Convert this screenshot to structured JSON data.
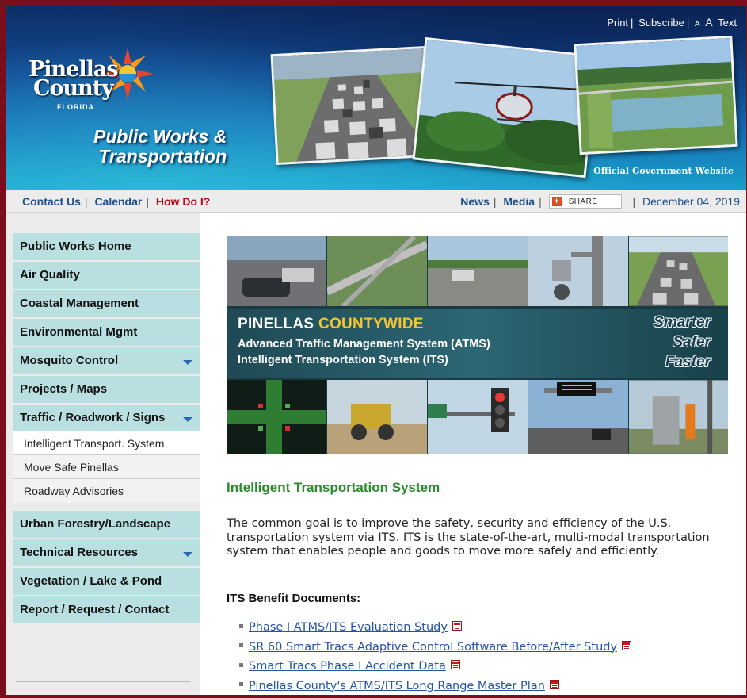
{
  "header": {
    "utility_links": {
      "print": "Print",
      "subscribe": "Subscribe",
      "text_small": "A",
      "text_large": "A",
      "text_label": "Text"
    },
    "logo": {
      "line1": "Pinellas",
      "line2": "County",
      "state": "FLORIDA"
    },
    "department": {
      "line1": "Public Works &",
      "line2": "Transportation"
    },
    "official_site": "Official Government Website"
  },
  "navbar": {
    "contact_us": "Contact Us",
    "calendar": "Calendar",
    "how_do_i": "How Do I?",
    "news": "News",
    "media": "Media",
    "share": "SHARE",
    "date": "December 04, 2019"
  },
  "sidebar": {
    "menu_top": [
      {
        "label": "Public Works Home"
      },
      {
        "label": "Air Quality"
      },
      {
        "label": "Coastal Management"
      },
      {
        "label": "Environmental Mgmt"
      },
      {
        "label": "Mosquito Control"
      },
      {
        "label": "Projects / Maps"
      },
      {
        "label": "Traffic / Roadwork / Signs"
      }
    ],
    "submenu": [
      {
        "label": "Intelligent Transport. System"
      },
      {
        "label": "Move Safe Pinellas"
      },
      {
        "label": "Roadway Advisories"
      }
    ],
    "menu_bottom": [
      {
        "label": "Urban Forestry/Landscape"
      },
      {
        "label": "Technical Resources"
      },
      {
        "label": "Vegetation / Lake & Pond"
      },
      {
        "label": "Report / Request / Contact"
      }
    ]
  },
  "banner": {
    "title_a": "PINELLAS ",
    "title_b": "COUNTYWIDE",
    "line2": "Advanced Traffic Management System (ATMS)",
    "line3": "Intelligent Transportation System (ITS)",
    "slogan": [
      "Smarter",
      "Safer",
      "Faster"
    ]
  },
  "main": {
    "page_title": "Intelligent Transportation System",
    "intro": "The common goal is to improve the safety, security and efficiency of the U.S. transportation system via ITS. ITS is the state-of-the-art, multi-modal transportation system that enables people and goods to move more safely and efficiently.",
    "docs_heading": "ITS Benefit Documents:",
    "documents": [
      "Phase I ATMS/ITS Evaluation Study",
      "SR 60 Smart Tracs Adaptive Control Software Before/After Study",
      "Smart Tracs Phase I Accident Data",
      "Pinellas County's ATMS/ITS Long Range Master Plan"
    ]
  }
}
